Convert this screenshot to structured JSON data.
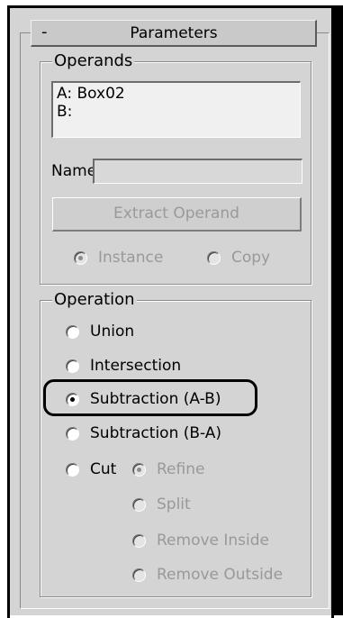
{
  "rollout": {
    "collapse_symbol": "-",
    "title": "Parameters"
  },
  "operands": {
    "group_label": "Operands",
    "list": [
      "A: Box02",
      "B:"
    ],
    "name_label": "Name:",
    "name_value": "",
    "extract_button": "Extract Operand",
    "instance_label": "Instance",
    "copy_label": "Copy",
    "selected_mode": "Instance"
  },
  "operation": {
    "group_label": "Operation",
    "union": "Union",
    "intersection": "Intersection",
    "subtraction_ab": "Subtraction (A-B)",
    "subtraction_ba": "Subtraction (B-A)",
    "cut": "Cut",
    "refine": "Refine",
    "split": "Split",
    "remove_inside": "Remove Inside",
    "remove_outside": "Remove Outside",
    "selected": "Subtraction (A-B)",
    "selected_cut_mode": "Refine"
  },
  "colors": {
    "panel_bg": "#d4d4d4",
    "disabled_text": "#999999",
    "highlight": "#000000"
  }
}
